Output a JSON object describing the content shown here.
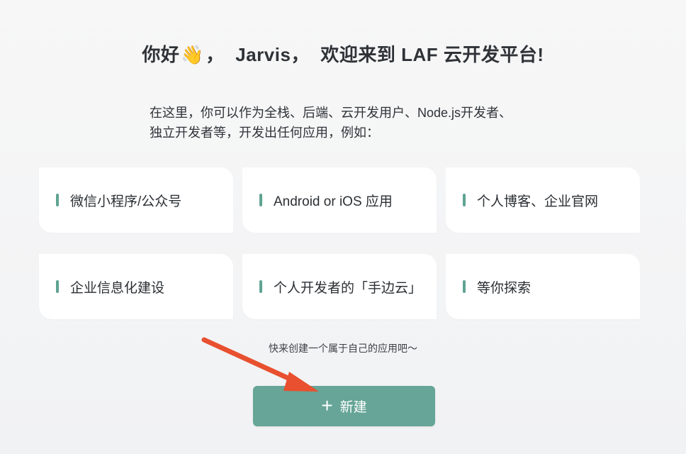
{
  "header": {
    "greeting": "你好",
    "wave_emoji": "👋",
    "separator_1": "，",
    "username": "Jarvis",
    "separator_2": "，",
    "welcome": "欢迎来到 LAF 云开发平台!"
  },
  "intro": {
    "line1": "在这里，你可以作为全栈、后端、云开发用户、Node.js开发者、",
    "line2": "独立开发者等，开发出任何应用，例如："
  },
  "cards": [
    {
      "label": "微信小程序/公众号"
    },
    {
      "label": "Android or iOS 应用"
    },
    {
      "label": "个人博客、企业官网"
    },
    {
      "label": "企业信息化建设"
    },
    {
      "label": "个人开发者的「手边云」"
    },
    {
      "label": "等你探索"
    }
  ],
  "hint": "快来创建一个属于自己的应用吧～",
  "create_button": {
    "icon": "plus-icon",
    "label": "新建"
  },
  "annotation": {
    "icon": "red-arrow-icon",
    "color": "#e8502f"
  },
  "colors": {
    "accent": "#66a597",
    "accent_bar": "#5fa392",
    "background": "#f2f3f5",
    "card": "#ffffff"
  }
}
